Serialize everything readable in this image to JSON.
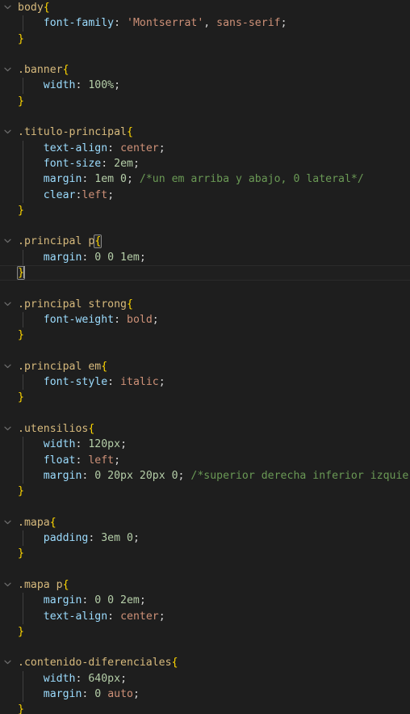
{
  "editor": {
    "language": "css",
    "theme": "dark-plus",
    "background_color": "#1e1e1e",
    "active_line_color": "#1f1f1f",
    "colors": {
      "selector": "#d7ba7d",
      "brace": "#ffd700",
      "property": "#9cdcfe",
      "string": "#ce9178",
      "keyword": "#ce9178",
      "number": "#b5cea8",
      "comment": "#6a9955",
      "default_text": "#d4d4d4",
      "indent_guide": "#404040",
      "fold_chevron": "#6e6e6e",
      "bracket_match_outline": "#888888",
      "caret": "#aeafad"
    },
    "fold_icon": "chevron-down-icon"
  },
  "lines": [
    {
      "n": 1,
      "fold": true,
      "indent": false,
      "active": false,
      "tokens": [
        {
          "t": "sel-tag",
          "v": "body"
        },
        {
          "t": "brace",
          "v": "{"
        }
      ]
    },
    {
      "n": 2,
      "fold": false,
      "indent": true,
      "active": false,
      "tokens": [
        {
          "t": "ws",
          "v": "    "
        },
        {
          "t": "prop",
          "v": "font-family"
        },
        {
          "t": "punct",
          "v": ": "
        },
        {
          "t": "str",
          "v": "'Montserrat'"
        },
        {
          "t": "punct",
          "v": ", "
        },
        {
          "t": "kw",
          "v": "sans-serif"
        },
        {
          "t": "punct",
          "v": ";"
        }
      ]
    },
    {
      "n": 3,
      "fold": false,
      "indent": false,
      "active": false,
      "tokens": [
        {
          "t": "brace",
          "v": "}"
        }
      ]
    },
    {
      "n": 4,
      "fold": false,
      "indent": false,
      "active": false,
      "blank": true,
      "tokens": []
    },
    {
      "n": 5,
      "fold": true,
      "indent": false,
      "active": false,
      "tokens": [
        {
          "t": "sel-class",
          "v": ".banner"
        },
        {
          "t": "brace",
          "v": "{"
        }
      ]
    },
    {
      "n": 6,
      "fold": false,
      "indent": true,
      "active": false,
      "tokens": [
        {
          "t": "ws",
          "v": "    "
        },
        {
          "t": "prop",
          "v": "width"
        },
        {
          "t": "punct",
          "v": ": "
        },
        {
          "t": "num",
          "v": "100%"
        },
        {
          "t": "punct",
          "v": ";"
        }
      ]
    },
    {
      "n": 7,
      "fold": false,
      "indent": false,
      "active": false,
      "tokens": [
        {
          "t": "brace",
          "v": "}"
        }
      ]
    },
    {
      "n": 8,
      "fold": false,
      "indent": false,
      "active": false,
      "blank": true,
      "tokens": []
    },
    {
      "n": 9,
      "fold": true,
      "indent": false,
      "active": false,
      "tokens": [
        {
          "t": "sel-class",
          "v": ".titulo-principal"
        },
        {
          "t": "brace",
          "v": "{"
        }
      ]
    },
    {
      "n": 10,
      "fold": false,
      "indent": true,
      "active": false,
      "tokens": [
        {
          "t": "ws",
          "v": "    "
        },
        {
          "t": "prop",
          "v": "text-align"
        },
        {
          "t": "punct",
          "v": ": "
        },
        {
          "t": "kw",
          "v": "center"
        },
        {
          "t": "punct",
          "v": ";"
        }
      ]
    },
    {
      "n": 11,
      "fold": false,
      "indent": true,
      "active": false,
      "tokens": [
        {
          "t": "ws",
          "v": "    "
        },
        {
          "t": "prop",
          "v": "font-size"
        },
        {
          "t": "punct",
          "v": ": "
        },
        {
          "t": "num",
          "v": "2em"
        },
        {
          "t": "punct",
          "v": ";"
        }
      ]
    },
    {
      "n": 12,
      "fold": false,
      "indent": true,
      "active": false,
      "tokens": [
        {
          "t": "ws",
          "v": "    "
        },
        {
          "t": "prop",
          "v": "margin"
        },
        {
          "t": "punct",
          "v": ": "
        },
        {
          "t": "num",
          "v": "1em 0"
        },
        {
          "t": "punct",
          "v": "; "
        },
        {
          "t": "comment",
          "v": "/*un em arriba y abajo, 0 lateral*/"
        }
      ]
    },
    {
      "n": 13,
      "fold": false,
      "indent": true,
      "active": false,
      "tokens": [
        {
          "t": "ws",
          "v": "    "
        },
        {
          "t": "prop",
          "v": "clear"
        },
        {
          "t": "punct",
          "v": ":"
        },
        {
          "t": "kw",
          "v": "left"
        },
        {
          "t": "punct",
          "v": ";"
        }
      ]
    },
    {
      "n": 14,
      "fold": false,
      "indent": false,
      "active": false,
      "tokens": [
        {
          "t": "brace",
          "v": "}"
        }
      ]
    },
    {
      "n": 15,
      "fold": false,
      "indent": false,
      "active": false,
      "blank": true,
      "tokens": []
    },
    {
      "n": 16,
      "fold": true,
      "indent": false,
      "active": false,
      "tokens": [
        {
          "t": "sel-class",
          "v": ".principal"
        },
        {
          "t": "punct",
          "v": " "
        },
        {
          "t": "sel-tag",
          "v": "p"
        },
        {
          "t": "brace bracket-match",
          "v": "{"
        }
      ]
    },
    {
      "n": 17,
      "fold": false,
      "indent": true,
      "active": false,
      "tokens": [
        {
          "t": "ws",
          "v": "    "
        },
        {
          "t": "prop",
          "v": "margin"
        },
        {
          "t": "punct",
          "v": ": "
        },
        {
          "t": "num",
          "v": "0 0 1em"
        },
        {
          "t": "punct",
          "v": ";"
        }
      ]
    },
    {
      "n": 18,
      "fold": false,
      "indent": false,
      "active": true,
      "caret_after": 1,
      "tokens": [
        {
          "t": "brace bracket-match",
          "v": "}"
        }
      ]
    },
    {
      "n": 19,
      "fold": false,
      "indent": false,
      "active": false,
      "blank": true,
      "tokens": []
    },
    {
      "n": 20,
      "fold": true,
      "indent": false,
      "active": false,
      "tokens": [
        {
          "t": "sel-class",
          "v": ".principal"
        },
        {
          "t": "punct",
          "v": " "
        },
        {
          "t": "sel-tag",
          "v": "strong"
        },
        {
          "t": "brace",
          "v": "{"
        }
      ]
    },
    {
      "n": 21,
      "fold": false,
      "indent": true,
      "active": false,
      "tokens": [
        {
          "t": "ws",
          "v": "    "
        },
        {
          "t": "prop",
          "v": "font-weight"
        },
        {
          "t": "punct",
          "v": ": "
        },
        {
          "t": "kw",
          "v": "bold"
        },
        {
          "t": "punct",
          "v": ";"
        }
      ]
    },
    {
      "n": 22,
      "fold": false,
      "indent": false,
      "active": false,
      "tokens": [
        {
          "t": "brace",
          "v": "}"
        }
      ]
    },
    {
      "n": 23,
      "fold": false,
      "indent": false,
      "active": false,
      "blank": true,
      "tokens": []
    },
    {
      "n": 24,
      "fold": true,
      "indent": false,
      "active": false,
      "tokens": [
        {
          "t": "sel-class",
          "v": ".principal"
        },
        {
          "t": "punct",
          "v": " "
        },
        {
          "t": "sel-tag",
          "v": "em"
        },
        {
          "t": "brace",
          "v": "{"
        }
      ]
    },
    {
      "n": 25,
      "fold": false,
      "indent": true,
      "active": false,
      "tokens": [
        {
          "t": "ws",
          "v": "    "
        },
        {
          "t": "prop",
          "v": "font-style"
        },
        {
          "t": "punct",
          "v": ": "
        },
        {
          "t": "kw",
          "v": "italic"
        },
        {
          "t": "punct",
          "v": ";"
        }
      ]
    },
    {
      "n": 26,
      "fold": false,
      "indent": false,
      "active": false,
      "tokens": [
        {
          "t": "brace",
          "v": "}"
        }
      ]
    },
    {
      "n": 27,
      "fold": false,
      "indent": false,
      "active": false,
      "blank": true,
      "tokens": []
    },
    {
      "n": 28,
      "fold": true,
      "indent": false,
      "active": false,
      "tokens": [
        {
          "t": "sel-class",
          "v": ".utensilios"
        },
        {
          "t": "brace",
          "v": "{"
        }
      ]
    },
    {
      "n": 29,
      "fold": false,
      "indent": true,
      "active": false,
      "tokens": [
        {
          "t": "ws",
          "v": "    "
        },
        {
          "t": "prop",
          "v": "width"
        },
        {
          "t": "punct",
          "v": ": "
        },
        {
          "t": "num",
          "v": "120px"
        },
        {
          "t": "punct",
          "v": ";"
        }
      ]
    },
    {
      "n": 30,
      "fold": false,
      "indent": true,
      "active": false,
      "tokens": [
        {
          "t": "ws",
          "v": "    "
        },
        {
          "t": "prop",
          "v": "float"
        },
        {
          "t": "punct",
          "v": ": "
        },
        {
          "t": "kw",
          "v": "left"
        },
        {
          "t": "punct",
          "v": ";"
        }
      ]
    },
    {
      "n": 31,
      "fold": false,
      "indent": true,
      "active": false,
      "tokens": [
        {
          "t": "ws",
          "v": "    "
        },
        {
          "t": "prop",
          "v": "margin"
        },
        {
          "t": "punct",
          "v": ": "
        },
        {
          "t": "num",
          "v": "0 20px 20px 0"
        },
        {
          "t": "punct",
          "v": "; "
        },
        {
          "t": "comment",
          "v": "/*superior derecha inferior izquierda"
        }
      ]
    },
    {
      "n": 32,
      "fold": false,
      "indent": false,
      "active": false,
      "tokens": [
        {
          "t": "brace",
          "v": "}"
        }
      ]
    },
    {
      "n": 33,
      "fold": false,
      "indent": false,
      "active": false,
      "blank": true,
      "tokens": []
    },
    {
      "n": 34,
      "fold": true,
      "indent": false,
      "active": false,
      "tokens": [
        {
          "t": "sel-class",
          "v": ".mapa"
        },
        {
          "t": "brace",
          "v": "{"
        }
      ]
    },
    {
      "n": 35,
      "fold": false,
      "indent": true,
      "active": false,
      "tokens": [
        {
          "t": "ws",
          "v": "    "
        },
        {
          "t": "prop",
          "v": "padding"
        },
        {
          "t": "punct",
          "v": ": "
        },
        {
          "t": "num",
          "v": "3em 0"
        },
        {
          "t": "punct",
          "v": ";"
        }
      ]
    },
    {
      "n": 36,
      "fold": false,
      "indent": false,
      "active": false,
      "tokens": [
        {
          "t": "brace",
          "v": "}"
        }
      ]
    },
    {
      "n": 37,
      "fold": false,
      "indent": false,
      "active": false,
      "blank": true,
      "tokens": []
    },
    {
      "n": 38,
      "fold": true,
      "indent": false,
      "active": false,
      "tokens": [
        {
          "t": "sel-class",
          "v": ".mapa"
        },
        {
          "t": "punct",
          "v": " "
        },
        {
          "t": "sel-tag",
          "v": "p"
        },
        {
          "t": "brace",
          "v": "{"
        }
      ]
    },
    {
      "n": 39,
      "fold": false,
      "indent": true,
      "active": false,
      "tokens": [
        {
          "t": "ws",
          "v": "    "
        },
        {
          "t": "prop",
          "v": "margin"
        },
        {
          "t": "punct",
          "v": ": "
        },
        {
          "t": "num",
          "v": "0 0 2em"
        },
        {
          "t": "punct",
          "v": ";"
        }
      ]
    },
    {
      "n": 40,
      "fold": false,
      "indent": true,
      "active": false,
      "tokens": [
        {
          "t": "ws",
          "v": "    "
        },
        {
          "t": "prop",
          "v": "text-align"
        },
        {
          "t": "punct",
          "v": ": "
        },
        {
          "t": "kw",
          "v": "center"
        },
        {
          "t": "punct",
          "v": ";"
        }
      ]
    },
    {
      "n": 41,
      "fold": false,
      "indent": false,
      "active": false,
      "tokens": [
        {
          "t": "brace",
          "v": "}"
        }
      ]
    },
    {
      "n": 42,
      "fold": false,
      "indent": false,
      "active": false,
      "blank": true,
      "tokens": []
    },
    {
      "n": 43,
      "fold": true,
      "indent": false,
      "active": false,
      "tokens": [
        {
          "t": "sel-class",
          "v": ".contenido-diferenciales"
        },
        {
          "t": "brace",
          "v": "{"
        }
      ]
    },
    {
      "n": 44,
      "fold": false,
      "indent": true,
      "active": false,
      "tokens": [
        {
          "t": "ws",
          "v": "    "
        },
        {
          "t": "prop",
          "v": "width"
        },
        {
          "t": "punct",
          "v": ": "
        },
        {
          "t": "num",
          "v": "640px"
        },
        {
          "t": "punct",
          "v": ";"
        }
      ]
    },
    {
      "n": 45,
      "fold": false,
      "indent": true,
      "active": false,
      "tokens": [
        {
          "t": "ws",
          "v": "    "
        },
        {
          "t": "prop",
          "v": "margin"
        },
        {
          "t": "punct",
          "v": ": "
        },
        {
          "t": "num",
          "v": "0"
        },
        {
          "t": "punct",
          "v": " "
        },
        {
          "t": "kw",
          "v": "auto"
        },
        {
          "t": "punct",
          "v": ";"
        }
      ]
    },
    {
      "n": 46,
      "fold": false,
      "indent": false,
      "active": false,
      "tokens": [
        {
          "t": "brace",
          "v": "}"
        }
      ]
    }
  ]
}
